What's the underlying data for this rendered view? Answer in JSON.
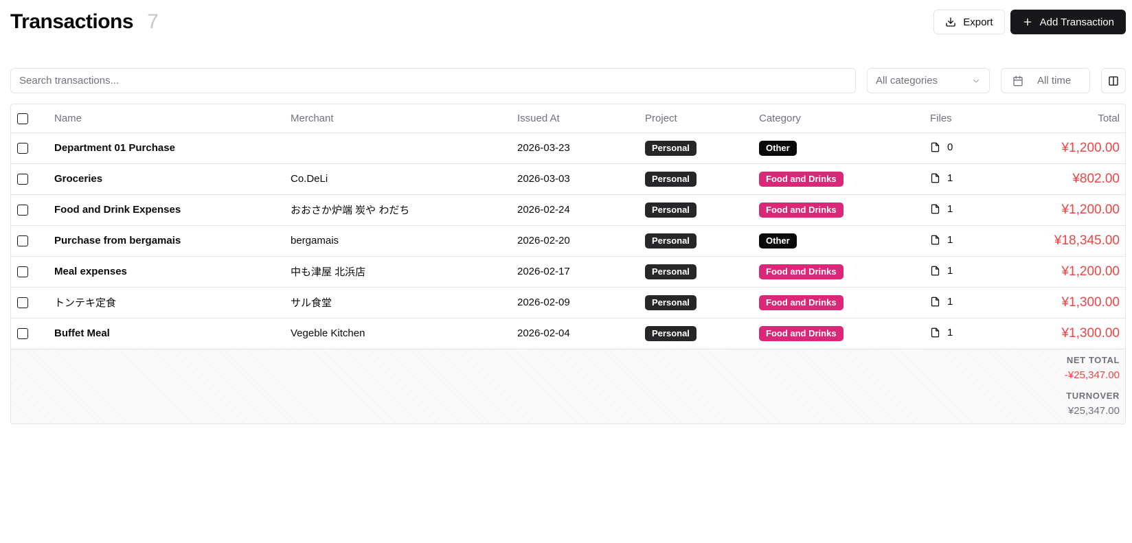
{
  "header": {
    "title": "Transactions",
    "count": "7",
    "export_label": "Export",
    "add_label": "Add Transaction"
  },
  "filters": {
    "search_placeholder": "Search transactions...",
    "category_label": "All categories",
    "date_label": "All time"
  },
  "table": {
    "columns": [
      "Name",
      "Merchant",
      "Issued At",
      "Project",
      "Category",
      "Files",
      "Total"
    ],
    "rows": [
      {
        "name": "Department 01 Purchase",
        "merchant": "",
        "issued": "2026-03-23",
        "project": "Personal",
        "category": "Other",
        "category_color": "#0a0a0a",
        "files": "0",
        "total": "¥1,200.00",
        "bold": true
      },
      {
        "name": "Groceries",
        "merchant": "Co.DeLi",
        "issued": "2026-03-03",
        "project": "Personal",
        "category": "Food and Drinks",
        "category_color": "#db2777",
        "files": "1",
        "total": "¥802.00",
        "bold": true
      },
      {
        "name": "Food and Drink Expenses",
        "merchant": "おおさか炉端 炭や わだち",
        "issued": "2026-02-24",
        "project": "Personal",
        "category": "Food and Drinks",
        "category_color": "#db2777",
        "files": "1",
        "total": "¥1,200.00",
        "bold": true
      },
      {
        "name": "Purchase from bergamais",
        "merchant": "bergamais",
        "issued": "2026-02-20",
        "project": "Personal",
        "category": "Other",
        "category_color": "#0a0a0a",
        "files": "1",
        "total": "¥18,345.00",
        "bold": true
      },
      {
        "name": "Meal expenses",
        "merchant": "中も津屋 北浜店",
        "issued": "2026-02-17",
        "project": "Personal",
        "category": "Food and Drinks",
        "category_color": "#db2777",
        "files": "1",
        "total": "¥1,200.00",
        "bold": true
      },
      {
        "name": "トンテキ定食",
        "merchant": "サル食堂",
        "issued": "2026-02-09",
        "project": "Personal",
        "category": "Food and Drinks",
        "category_color": "#db2777",
        "files": "1",
        "total": "¥1,300.00",
        "bold": false
      },
      {
        "name": "Buffet Meal",
        "merchant": "Vegeble Kitchen",
        "issued": "2026-02-04",
        "project": "Personal",
        "category": "Food and Drinks",
        "category_color": "#db2777",
        "files": "1",
        "total": "¥1,300.00",
        "bold": true
      }
    ]
  },
  "summary": {
    "net_total_label": "NET TOTAL",
    "net_total_value": "-¥25,347.00",
    "turnover_label": "TURNOVER",
    "turnover_value": "¥25,347.00"
  },
  "icons": {
    "export": "download-icon",
    "add": "plus-icon",
    "category_dropdown": "chevron-down-icon",
    "date": "calendar-icon",
    "columns": "columns-icon",
    "file": "file-icon"
  },
  "colors": {
    "amount": "#ef4444",
    "food_badge": "#db2777",
    "other_badge": "#0a0a0a",
    "project_badge": "#27272a",
    "primary_button": "#18181b"
  }
}
